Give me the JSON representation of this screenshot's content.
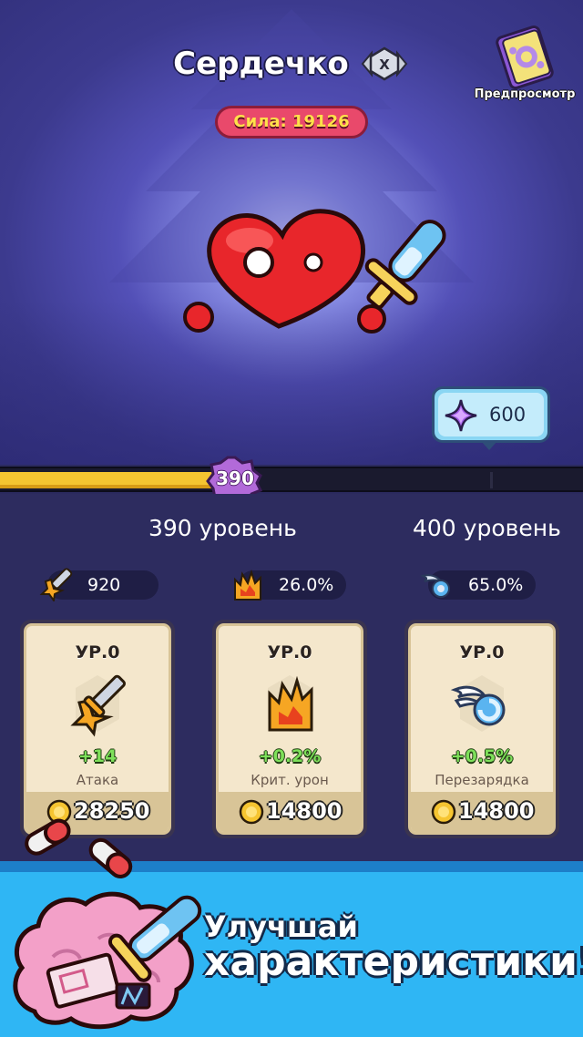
{
  "hero": {
    "name": "Сердечко",
    "rank_badge_letter": "X",
    "power_label": "Сила: 19126",
    "preview_label": "Предпросмотр",
    "character": "heart-with-sword"
  },
  "upgrade_cost": {
    "icon": "purple-gem-icon",
    "value": "600"
  },
  "progress": {
    "current_level_badge": "390",
    "fill_fraction": 0.37,
    "current_level_label": "390 уровень",
    "next_level_label": "400 уровень"
  },
  "stats": [
    {
      "icon": "sword-star-icon",
      "value": "920"
    },
    {
      "icon": "crit-flame-icon",
      "value": "26.0%"
    },
    {
      "icon": "wing-swirl-icon",
      "value": "65.0%"
    }
  ],
  "cards": [
    {
      "level": "УР.0",
      "icon": "sword-star-icon",
      "bonus": "+14",
      "name": "Атака",
      "cost": "28250"
    },
    {
      "level": "УР.0",
      "icon": "crit-flame-icon",
      "bonus": "+0.2%",
      "name": "Крит. урон",
      "cost": "14800"
    },
    {
      "level": "УР.0",
      "icon": "wing-swirl-icon",
      "bonus": "+0.5%",
      "name": "Перезарядка",
      "cost": "14800"
    }
  ],
  "promo": {
    "line1": "Улучшай",
    "line2": "характеристики!"
  },
  "colors": {
    "background": "#2d2c5f",
    "progress_fill": "#f5c531",
    "power_pill": "#e9496b",
    "bonus_green": "#7ee05a",
    "promo_blue": "#2fb6f4"
  }
}
